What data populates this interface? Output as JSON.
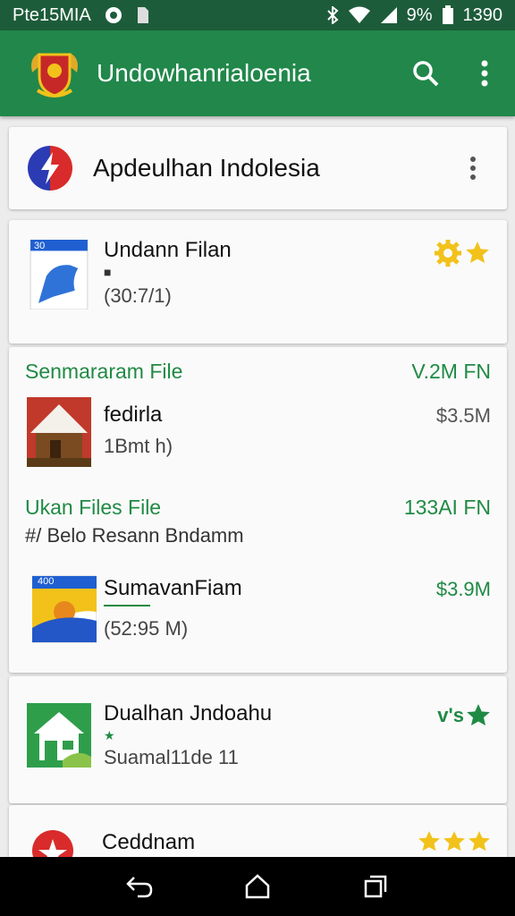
{
  "status_bar": {
    "time_left": "Pte15MIA",
    "battery_percent": "9%",
    "clock": "1390"
  },
  "app_bar": {
    "title": "Undowhanrialoenia",
    "actions": [
      "search-icon",
      "more-vert-icon"
    ]
  },
  "header_card": {
    "title": "Apdeulhan Indolesia"
  },
  "items": {
    "item1": {
      "title": "Undann Filan",
      "subtitle": "(30:7/1)",
      "thumb_tag": "30"
    },
    "section1": {
      "title": "Senmararam File",
      "right": "V.2M FN"
    },
    "item2": {
      "title": "fedirla",
      "subtitle": "1Bmt h)",
      "price": "$3.5M"
    },
    "section2": {
      "title": "Ukan Files File",
      "right": "133AI FN",
      "subtitle": "#/ Belo Resann Bndamm"
    },
    "item3": {
      "title": "SumavanFiam",
      "subtitle": "(52:95 M)",
      "price": "$3.9M",
      "thumb_tag": "400"
    },
    "item4": {
      "title": "Dualhan Jndoahu",
      "subtitle": "Suamal11de 11",
      "rating_text": "v's"
    },
    "item5": {
      "title": "Ceddnam"
    }
  },
  "colors": {
    "status_bar": "#1d5c3a",
    "app_bar": "#21874a",
    "accent_green": "#1f8a44",
    "star_yellow": "#f2c21b"
  },
  "nav_bar": [
    "back-icon",
    "home-icon",
    "recents-icon"
  ]
}
